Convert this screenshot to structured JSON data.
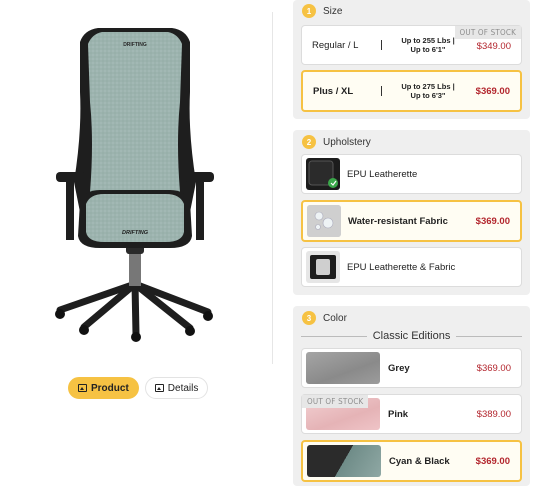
{
  "view_buttons": [
    {
      "label": "Product",
      "icon": "image-icon",
      "active": true
    },
    {
      "label": "Details",
      "icon": "image-icon",
      "active": false
    }
  ],
  "chair": {
    "backrest_brand": "DRIFTING",
    "seat_brand": "DRIFTING"
  },
  "size_section": {
    "number": "1",
    "title": "Size",
    "options": [
      {
        "name": "Regular / L",
        "desc_line1": "Up to 255 Lbs |",
        "desc_line2": "Up to 6'1\"",
        "price": "$349.00",
        "badge": "OUT OF STOCK",
        "selected": false
      },
      {
        "name": "Plus / XL",
        "desc_line1": "Up to 275 Lbs |",
        "desc_line2": "Up to 6'3\"",
        "price": "$369.00",
        "badge": "",
        "selected": true
      }
    ]
  },
  "upholstery_section": {
    "number": "2",
    "title": "Upholstery",
    "options": [
      {
        "label": "EPU Leatherette",
        "price": "",
        "selected": false
      },
      {
        "label": "Water-resistant Fabric",
        "price": "$369.00",
        "selected": true
      },
      {
        "label": "EPU Leatherette & Fabric",
        "price": "",
        "selected": false
      }
    ]
  },
  "color_section": {
    "number": "3",
    "title": "Color",
    "group_title": "Classic Editions",
    "options": [
      {
        "label": "Grey",
        "price": "$369.00",
        "badge": "",
        "selected": false
      },
      {
        "label": "Pink",
        "price": "$389.00",
        "badge": "OUT OF STOCK",
        "selected": false
      },
      {
        "label": "Cyan & Black",
        "price": "$369.00",
        "badge": "",
        "selected": true
      }
    ]
  },
  "colors": {
    "accent": "#f6c243",
    "price": "#b3262e",
    "fabric": "#8fa8a4",
    "frame": "#1e1e1e"
  }
}
